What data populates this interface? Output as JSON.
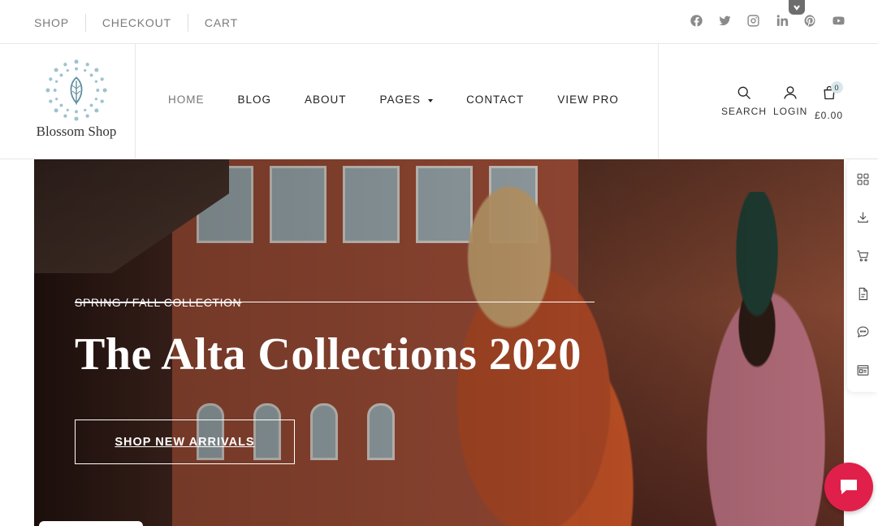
{
  "topbar": {
    "links": [
      "SHOP",
      "CHECKOUT",
      "CART"
    ],
    "social_icons": [
      "facebook-icon",
      "twitter-icon",
      "instagram-icon",
      "linkedin-icon",
      "pinterest-icon",
      "youtube-icon"
    ]
  },
  "header": {
    "logo_text": "Blossom Shop",
    "nav": [
      {
        "label": "HOME",
        "active": true
      },
      {
        "label": "BLOG"
      },
      {
        "label": "ABOUT"
      },
      {
        "label": "PAGES",
        "has_dropdown": true
      },
      {
        "label": "CONTACT"
      },
      {
        "label": "VIEW PRO"
      }
    ],
    "search_label": "SEARCH",
    "login_label": "LOGIN",
    "cart_total": "£0.00",
    "cart_count": "0"
  },
  "hero": {
    "kicker": "SPRING / FALL COLLECTION",
    "title": "The Alta Collections 2020",
    "button_label": "SHOP NEW ARRIVALS"
  },
  "toolbar": {
    "icons": [
      "grid-icon",
      "download-icon",
      "cart-icon",
      "document-icon",
      "chat-icon",
      "newspaper-icon"
    ]
  },
  "colors": {
    "accent": "#e0204a",
    "nav_text": "#222222",
    "muted_text": "#7b7b7b",
    "logo_accent": "#9ec3cf"
  }
}
